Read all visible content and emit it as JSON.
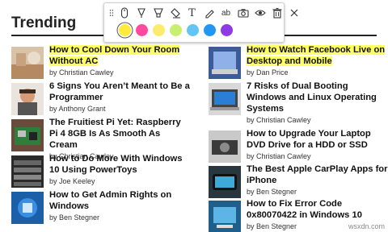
{
  "heading": "Trending",
  "toolbar": {
    "tools": [
      "drag-handle-icon",
      "mouse-icon",
      "pen-icon",
      "highlighter-icon",
      "eraser-icon",
      "text-icon",
      "spellcheck-icon",
      "camera-icon",
      "eye-icon",
      "trash-icon",
      "close-icon"
    ],
    "text_tool_glyph": "T",
    "ab_glyph": "ab",
    "colors": [
      "#ffeb3b",
      "#ff4aa0",
      "#ffeb6b",
      "#c8f06e",
      "#63c5f5",
      "#2196f3",
      "#8e3be6"
    ]
  },
  "left_articles": [
    {
      "title": "How to Cool Down Your Room Without AC",
      "author": "by Christian Cawley",
      "highlighted": true
    },
    {
      "title": "6 Signs You Aren’t Meant to Be a Programmer",
      "author": "by Anthony Grant",
      "highlighted": false
    },
    {
      "title": "The Fruitiest Pi Yet: Raspberry Pi 4 8GB Is As Smooth As Cream",
      "author": "by Christian Cawley",
      "highlighted": false
    },
    {
      "title": "How to Do More With Windows 10 Using PowerToys",
      "author": "by Joe Keeley",
      "highlighted": false
    },
    {
      "title": "How to Get Admin Rights on Windows",
      "author": "by Ben Stegner",
      "highlighted": false
    }
  ],
  "right_articles": [
    {
      "title": "How to Watch Facebook Live on Desktop and Mobile",
      "author": "by Dan Price",
      "highlighted": true
    },
    {
      "title": "7 Risks of Dual Booting Windows and Linux Operating Systems",
      "author": "by Christian Cawley",
      "highlighted": false
    },
    {
      "title": "How to Upgrade Your Laptop DVD Drive for a HDD or SSD",
      "author": "by Christian Cawley",
      "highlighted": false
    },
    {
      "title": "The Best Apple CarPlay Apps for iPhone",
      "author": "by Ben Stegner",
      "highlighted": false
    },
    {
      "title": "How to Fix Error Code 0x80070422 in Windows 10",
      "author": "by Ben Stegner",
      "highlighted": false
    }
  ],
  "watermark": "wsxdn.com"
}
